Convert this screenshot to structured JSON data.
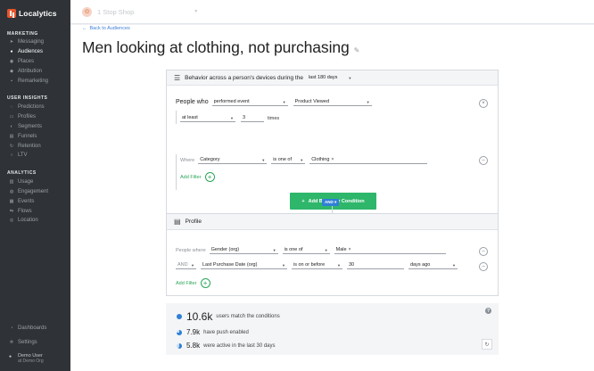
{
  "brand": {
    "name": "Localytics"
  },
  "sidebar": {
    "sections": [
      {
        "title": "MARKETING",
        "items": [
          {
            "label": "Messaging",
            "icon": "paper-plane-icon",
            "active": false
          },
          {
            "label": "Audiences",
            "icon": "people-icon",
            "active": true
          },
          {
            "label": "Places",
            "icon": "map-pin-icon",
            "active": false
          },
          {
            "label": "Attribution",
            "icon": "attribution-icon",
            "active": false
          },
          {
            "label": "Remarketing",
            "icon": "remarketing-icon",
            "active": false
          }
        ]
      },
      {
        "title": "USER INSIGHTS",
        "items": [
          {
            "label": "Predictions",
            "icon": "lightbulb-icon",
            "active": false
          },
          {
            "label": "Profiles",
            "icon": "profile-icon",
            "active": false
          },
          {
            "label": "Segments",
            "icon": "segments-icon",
            "active": false
          },
          {
            "label": "Funnels",
            "icon": "funnel-icon",
            "active": false
          },
          {
            "label": "Retention",
            "icon": "retention-icon",
            "active": false
          },
          {
            "label": "LTV",
            "icon": "ltv-icon",
            "active": false
          }
        ]
      },
      {
        "title": "ANALYTICS",
        "items": [
          {
            "label": "Usage",
            "icon": "usage-icon",
            "active": false
          },
          {
            "label": "Engagement",
            "icon": "engagement-icon",
            "active": false
          },
          {
            "label": "Events",
            "icon": "events-icon",
            "active": false
          },
          {
            "label": "Flows",
            "icon": "flows-icon",
            "active": false
          },
          {
            "label": "Location",
            "icon": "location-icon",
            "active": false
          }
        ]
      }
    ],
    "bottom": {
      "dashboards": "Dashboards",
      "settings": "Settings",
      "user_name": "Demo User",
      "user_org": "at Demo Org"
    }
  },
  "topbar": {
    "app_name": "1 Stop Shop"
  },
  "main": {
    "back_link": "Back to Audiences",
    "title": "Men looking at clothing, not purchasing"
  },
  "behavior": {
    "header_text": "Behavior across a person's devices during the",
    "timeframe": "last 180 days",
    "people_who": "People who",
    "event_verb": "performed event",
    "event_name": "Product Viewed",
    "count_op": "at least",
    "count_value": "3",
    "count_unit": "times",
    "where": "Where",
    "attr": "Category",
    "attr_op": "is one of",
    "attr_value": "Clothing",
    "add_filter": "Add Filter",
    "add_condition": "Add Behavior Condition"
  },
  "and_label": "AND",
  "profile": {
    "header_text": "Profile",
    "row1": {
      "prefix": "People where",
      "attr": "Gender (org)",
      "op": "is one of",
      "value": "Male"
    },
    "row2": {
      "prefix": "AND",
      "attr": "Last Purchase Date (org)",
      "op": "is on or before",
      "value": "30",
      "unit": "days ago"
    },
    "add_filter": "Add Filter"
  },
  "summary": {
    "match_count": "10.6k",
    "match_text": "users match the conditions",
    "push_count": "7.9k",
    "push_text": "have push enabled",
    "active_count": "5.8k",
    "active_text": "were active in the last 30 days"
  },
  "colors": {
    "accent_blue": "#2f7fd6",
    "accent_green": "#2eb66b",
    "brand_orange": "#e8542a",
    "sidebar_bg": "#2f3337"
  }
}
